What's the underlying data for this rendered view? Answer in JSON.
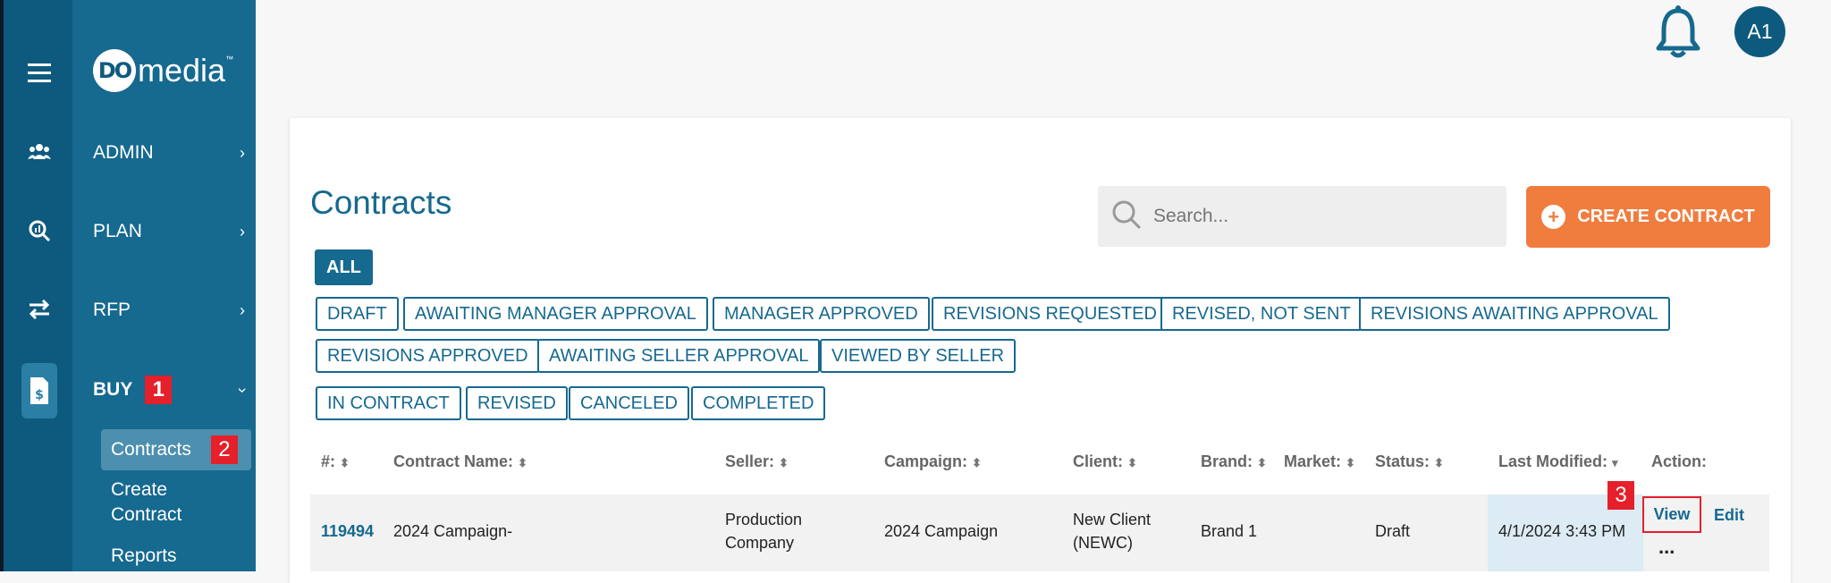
{
  "brand": {
    "logo_mark": "DO",
    "logo_text": "media",
    "logo_tm": "™"
  },
  "user": {
    "initials": "A1"
  },
  "nav": {
    "items": [
      {
        "label": "ADMIN",
        "icon": "users-icon"
      },
      {
        "label": "PLAN",
        "icon": "analytics-icon"
      },
      {
        "label": "RFP",
        "icon": "transfer-icon"
      },
      {
        "label": "BUY",
        "icon": "invoice-icon",
        "badge": "1"
      }
    ],
    "buy_sub": [
      {
        "label": "Contracts",
        "badge": "2"
      },
      {
        "label": "Create Contract"
      },
      {
        "label": "Reports"
      }
    ]
  },
  "page": {
    "title": "Contracts",
    "search_placeholder": "Search...",
    "create_label": "CREATE CONTRACT"
  },
  "filters": [
    "ALL",
    "DRAFT",
    "AWAITING MANAGER APPROVAL",
    "MANAGER APPROVED",
    "REVISIONS REQUESTED",
    "REVISED, NOT SENT",
    "REVISIONS AWAITING APPROVAL",
    "REVISIONS APPROVED",
    "AWAITING SELLER APPROVAL",
    "VIEWED BY SELLER",
    "IN CONTRACT",
    "REVISED",
    "CANCELED",
    "COMPLETED"
  ],
  "table": {
    "headers": [
      "#:",
      "Contract Name:",
      "Seller:",
      "Campaign:",
      "Client:",
      "Brand:",
      "Market:",
      "Status:",
      "Last Modified:",
      "Action:"
    ],
    "rows": [
      {
        "id": "119494",
        "name": "2024 Campaign-",
        "seller": "Production Company",
        "campaign": "2024 Campaign",
        "client": "New Client (NEWC)",
        "brand": "Brand 1",
        "market": "",
        "status": "Draft",
        "modified": "4/1/2024 3:43 PM",
        "view": "View",
        "edit": "Edit",
        "more": "...",
        "badge": "3"
      }
    ]
  }
}
